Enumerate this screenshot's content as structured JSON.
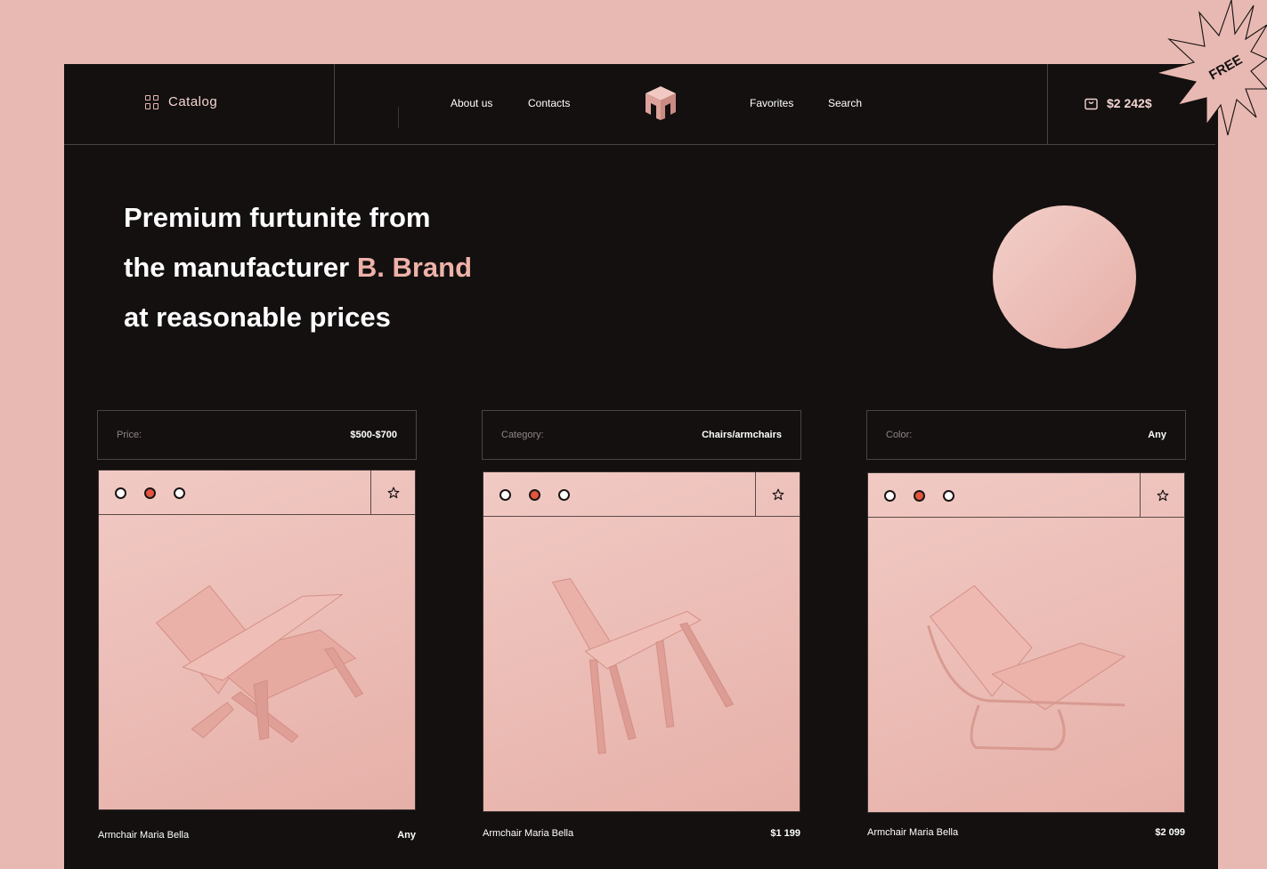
{
  "header": {
    "catalog_label": "Catalog",
    "nav_left": [
      "About us",
      "Contacts"
    ],
    "nav_right": [
      "Favorites",
      "Search"
    ],
    "cart_total": "$2 242$"
  },
  "badge": {
    "label": "FREE"
  },
  "hero": {
    "line1": "Premium furtunite from",
    "line2_prefix": "the manufacturer ",
    "line2_brand": "B. Brand",
    "line3": "at reasonable prices"
  },
  "filters": [
    {
      "label": "Price:",
      "value": "$500-$700"
    },
    {
      "label": "Category:",
      "value": "Chairs/armchairs"
    },
    {
      "label": "Color:",
      "value": "Any"
    }
  ],
  "products": [
    {
      "name": "Armchair Maria Bella",
      "price": "Any",
      "selected_color": 2
    },
    {
      "name": "Armchair Maria Bella",
      "price": "$1 199",
      "selected_color": 2
    },
    {
      "name": "Armchair Maria Bella",
      "price": "$2 099",
      "selected_color": 2
    }
  ],
  "colors": {
    "page_bg": "#e8b9b2",
    "frame_bg": "#141010",
    "accent": "#eeb2a8",
    "dot_selected": "#e4553e"
  }
}
